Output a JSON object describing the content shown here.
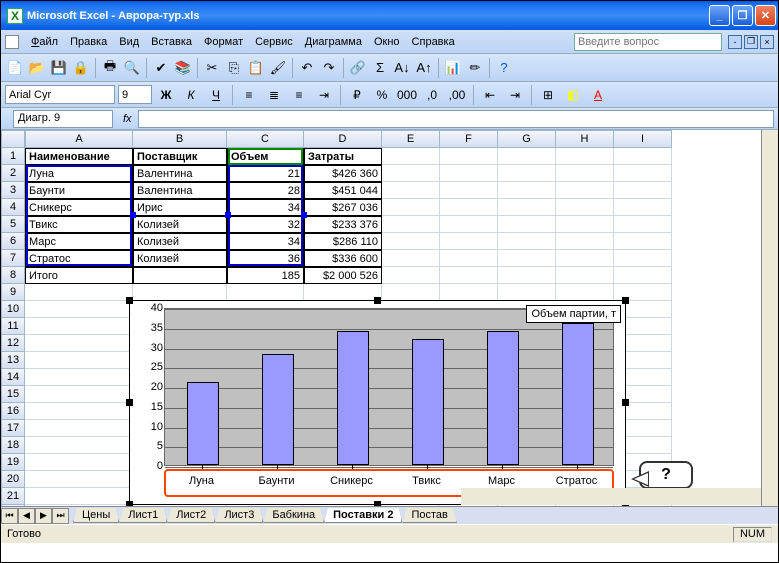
{
  "window": {
    "app": "Microsoft Excel",
    "doc": "Аврора-тур.xls"
  },
  "menu": {
    "file": "Файл",
    "edit": "Правка",
    "view": "Вид",
    "insert": "Вставка",
    "format": "Формат",
    "service": "Сервис",
    "diagram": "Диаграмма",
    "window": "Окно",
    "help": "Справка",
    "ask": "Введите вопрос"
  },
  "font": {
    "name": "Arial Cyr",
    "size": "9"
  },
  "namebox": "Диагр. 9",
  "columns": [
    "A",
    "B",
    "C",
    "D",
    "E",
    "F",
    "G",
    "H",
    "I"
  ],
  "headers": {
    "a": "Наименование товара",
    "b": "Поставщик",
    "c": "Объем партии, т",
    "d": "Затраты"
  },
  "rows": [
    {
      "a": "Луна",
      "b": "Валентина",
      "c": "21",
      "d": "$426 360"
    },
    {
      "a": "Баунти",
      "b": "Валентина",
      "c": "28",
      "d": "$451 044"
    },
    {
      "a": "Сникерс",
      "b": "Ирис",
      "c": "34",
      "d": "$267 036"
    },
    {
      "a": "Твикс",
      "b": "Колизей",
      "c": "32",
      "d": "$233 376"
    },
    {
      "a": "Марс",
      "b": "Колизей",
      "c": "34",
      "d": "$286 110"
    },
    {
      "a": "Стратос",
      "b": "Колизей",
      "c": "36",
      "d": "$336 600"
    }
  ],
  "total": {
    "a": "Итого",
    "c": "185",
    "d": "$2 000 526"
  },
  "chart_data": {
    "type": "bar",
    "title": "",
    "legend": "Объем партии, т",
    "categories": [
      "Луна",
      "Баунти",
      "Сникерс",
      "Твикс",
      "Марс",
      "Стратос"
    ],
    "values": [
      21,
      28,
      34,
      32,
      34,
      36
    ],
    "ylim": [
      0,
      40
    ],
    "yticks": [
      0,
      5,
      10,
      15,
      20,
      25,
      30,
      35,
      40
    ],
    "xlabel": "",
    "ylabel": ""
  },
  "callout": "?",
  "tabs": [
    "Цены",
    "Лист1",
    "Лист2",
    "Лист3",
    "Бабкина",
    "Поставки 2",
    "Постав"
  ],
  "active_tab": "Поставки 2",
  "status": {
    "ready": "Готово",
    "num": "NUM"
  }
}
